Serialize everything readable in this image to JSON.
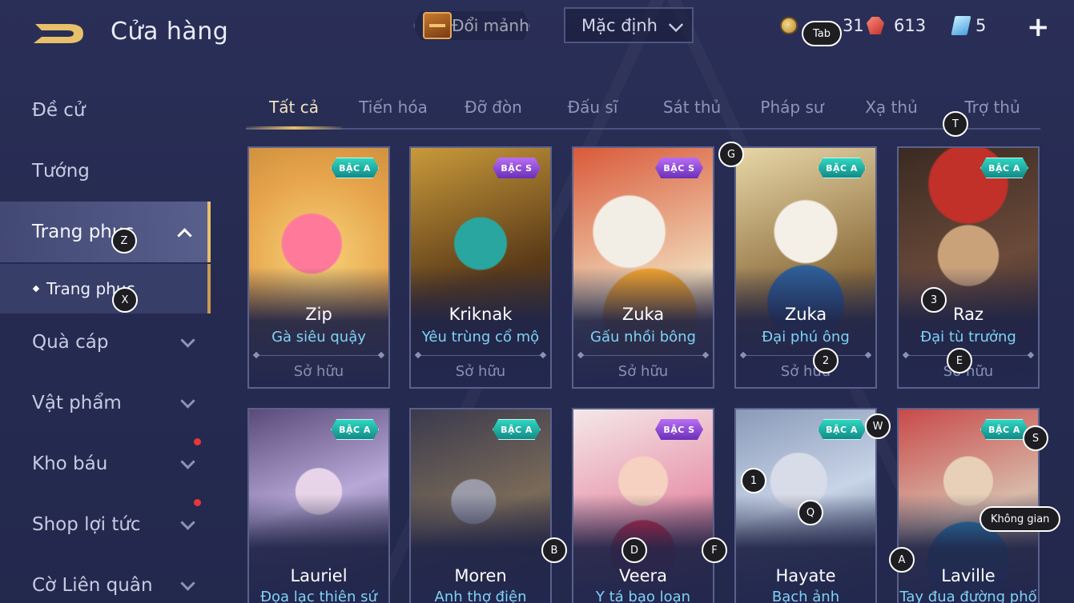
{
  "header": {
    "title": "Cửa hàng",
    "exchange_label": "Đổi mảnh",
    "sort_value": "Mặc định",
    "gold": "31",
    "rubies": "613",
    "vouchers": "5",
    "plus": "+"
  },
  "sidebar": {
    "items": [
      {
        "label": "Đề cử"
      },
      {
        "label": "Tướng"
      },
      {
        "label": "Trang phục"
      },
      {
        "label": "Trang phục"
      },
      {
        "label": "Quà cáp"
      },
      {
        "label": "Vật phẩm"
      },
      {
        "label": "Kho báu"
      },
      {
        "label": "Shop lợi tức"
      },
      {
        "label": "Cờ Liên quân"
      }
    ]
  },
  "tabs": [
    "Tất cả",
    "Tiến hóa",
    "Đỡ đòn",
    "Đấu sĩ",
    "Sát thủ",
    "Pháp sư",
    "Xạ thủ",
    "Trợ thủ"
  ],
  "cards": [
    {
      "hero": "Zip",
      "skin": "Gà siêu quậy",
      "tier": "BẬC A",
      "status": "Sở hữu"
    },
    {
      "hero": "Kriknak",
      "skin": "Yêu trùng cổ mộ",
      "tier": "BẬC S",
      "status": "Sở hữu"
    },
    {
      "hero": "Zuka",
      "skin": "Gấu nhồi bông",
      "tier": "BẬC S",
      "status": "Sở hữu"
    },
    {
      "hero": "Zuka",
      "skin": "Đại phú ông",
      "tier": "BẬC A",
      "status": "Sở hữu"
    },
    {
      "hero": "Raz",
      "skin": "Đại tù trưởng",
      "tier": "BẬC A",
      "status": "Sở hữu"
    },
    {
      "hero": "Lauriel",
      "skin": "Đọa lạc thiên sứ",
      "tier": "BẬC A",
      "status": ""
    },
    {
      "hero": "Moren",
      "skin": "Anh thợ điện",
      "tier": "BẬC A",
      "status": ""
    },
    {
      "hero": "Veera",
      "skin": "Y tá bạo loạn",
      "tier": "BẬC S",
      "status": ""
    },
    {
      "hero": "Hayate",
      "skin": "Bạch ảnh",
      "tier": "BẬC A",
      "status": ""
    },
    {
      "hero": "Laville",
      "skin": "Tay đua đường phố",
      "tier": "BẬC A",
      "status": ""
    }
  ],
  "hotkeys": {
    "tab": "Tab",
    "z": "Z",
    "x": "X",
    "t": "T",
    "g": "G",
    "k3": "3",
    "k2": "2",
    "e": "E",
    "w": "W",
    "s": "S",
    "k1": "1",
    "q": "Q",
    "space": "Không gian",
    "b": "B",
    "d": "D",
    "f": "F",
    "a": "A"
  },
  "colors": {
    "accent_gold": "#e8c06a",
    "skin_name": "#7fd2f5",
    "tier_a": "#2fd6c0",
    "tier_s": "#b86ef5",
    "notify_dot": "#e8363a"
  }
}
